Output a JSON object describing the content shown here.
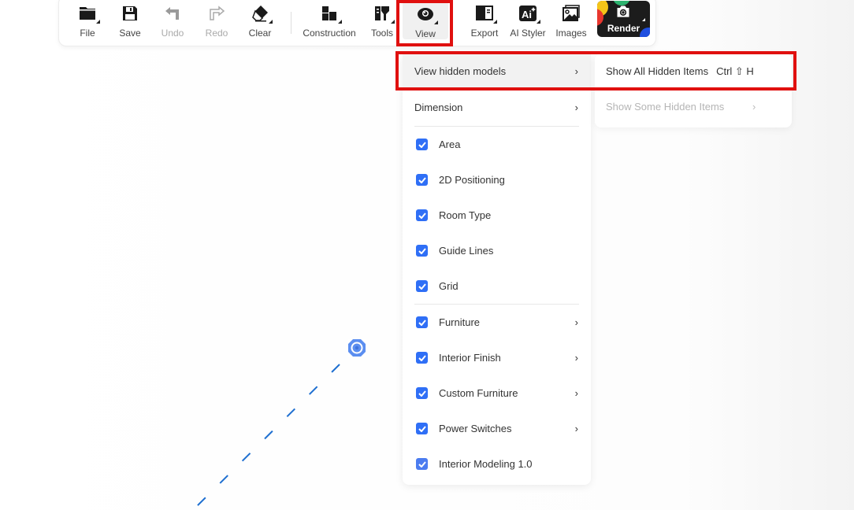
{
  "toolbar": {
    "buttons": [
      {
        "id": "file",
        "label": "File",
        "icon": "folder-icon",
        "has_menu": true,
        "disabled": false
      },
      {
        "id": "save",
        "label": "Save",
        "icon": "floppy-disk-icon",
        "has_menu": false,
        "disabled": false
      },
      {
        "id": "undo",
        "label": "Undo",
        "icon": "undo-arrow-icon",
        "has_menu": false,
        "disabled": true
      },
      {
        "id": "redo",
        "label": "Redo",
        "icon": "redo-arrow-icon",
        "has_menu": false,
        "disabled": true
      },
      {
        "id": "clear",
        "label": "Clear",
        "icon": "eraser-icon",
        "has_menu": true,
        "disabled": false
      },
      {
        "id": "construction",
        "label": "Construction",
        "icon": "construction-blocks-icon",
        "has_menu": true,
        "disabled": false
      },
      {
        "id": "tools",
        "label": "Tools",
        "icon": "paint-roller-icon",
        "has_menu": true,
        "disabled": false
      },
      {
        "id": "view",
        "label": "View",
        "icon": "eye-icon",
        "has_menu": true,
        "disabled": false,
        "active": true
      },
      {
        "id": "export",
        "label": "Export",
        "icon": "export-panel-icon",
        "has_menu": true,
        "disabled": false
      },
      {
        "id": "ai_styler",
        "label": "AI Styler",
        "icon": "ai-sparkle-icon",
        "has_menu": true,
        "disabled": false
      },
      {
        "id": "images",
        "label": "Images",
        "icon": "image-gallery-icon",
        "has_menu": false,
        "disabled": false
      }
    ],
    "render": {
      "label": "Render",
      "icon": "camera-icon"
    }
  },
  "view_menu": {
    "items": [
      {
        "label": "View hidden models",
        "type": "submenu",
        "highlighted": true
      },
      {
        "label": "Dimension",
        "type": "submenu"
      },
      {
        "label": "Area",
        "type": "checkbox",
        "checked": true
      },
      {
        "label": "2D Positioning",
        "type": "checkbox",
        "checked": true
      },
      {
        "label": "Room Type",
        "type": "checkbox",
        "checked": true
      },
      {
        "label": "Guide Lines",
        "type": "checkbox",
        "checked": true
      },
      {
        "label": "Grid",
        "type": "checkbox",
        "checked": true
      },
      {
        "label": "Furniture",
        "type": "checkbox-submenu",
        "checked": true
      },
      {
        "label": "Interior Finish",
        "type": "checkbox-submenu",
        "checked": true
      },
      {
        "label": "Custom Furniture",
        "type": "checkbox-submenu",
        "checked": true
      },
      {
        "label": "Power Switches",
        "type": "checkbox-submenu",
        "checked": true
      },
      {
        "label": "Interior Modeling 1.0",
        "type": "checkbox",
        "checked": true
      }
    ]
  },
  "hidden_submenu": {
    "items": [
      {
        "label": "Show All Hidden Items",
        "shortcut": "Ctrl ⇧ H",
        "disabled": false
      },
      {
        "label": "Show Some Hidden Items",
        "disabled": true
      }
    ]
  },
  "colors": {
    "accent": "#2f6ff6",
    "highlight_box": "#e0100f",
    "guide_line": "#1e6fd0"
  },
  "chevron": "›"
}
